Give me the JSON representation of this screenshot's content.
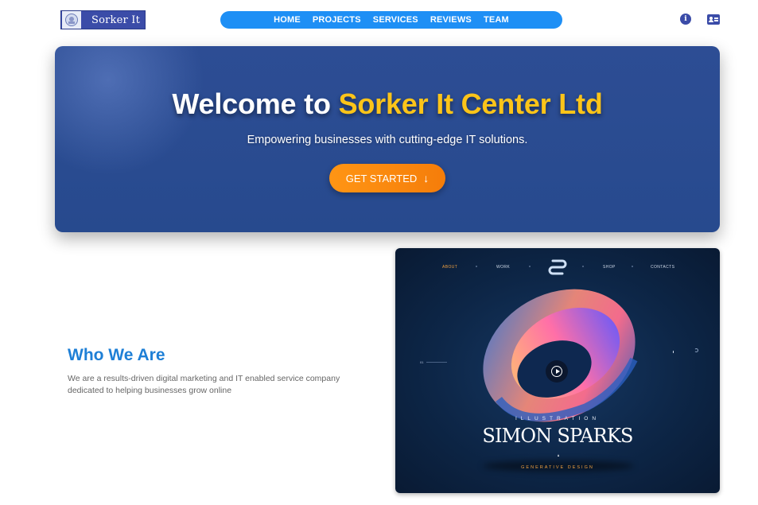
{
  "header": {
    "logo_text": "Sorker It",
    "nav": [
      "HOME",
      "PROJECTS",
      "SERVICES",
      "REVIEWS",
      "TEAM"
    ],
    "icons": [
      "info-icon",
      "contact-card-icon"
    ],
    "colors": {
      "nav_bg": "#1e8ff5",
      "brand": "#3b4ca8"
    }
  },
  "hero": {
    "title_prefix": "Welcome to ",
    "title_highlight": "Sorker It Center Ltd",
    "subtitle": "Empowering businesses with cutting-edge IT solutions.",
    "cta_label": "GET STARTED",
    "cta_icon": "arrow-down-icon",
    "colors": {
      "highlight": "#fcc419",
      "cta": "#ff9514",
      "bg": "#2d4d94"
    }
  },
  "about": {
    "title": "Who We Are",
    "text": "We are a results-driven digital marketing and IT enabled service company dedicated to helping businesses grow online",
    "title_color": "#1e7fd6"
  },
  "showcase": {
    "nav": [
      "ABOUT",
      "WORK",
      "SHOP",
      "CONTACTS"
    ],
    "index": "01",
    "kicker": "ILLUSTRATION",
    "name": "SIMON SPARKS",
    "tagline": "GENERATIVE DESIGN",
    "icons": [
      "s-monogram-logo",
      "play-icon"
    ]
  }
}
